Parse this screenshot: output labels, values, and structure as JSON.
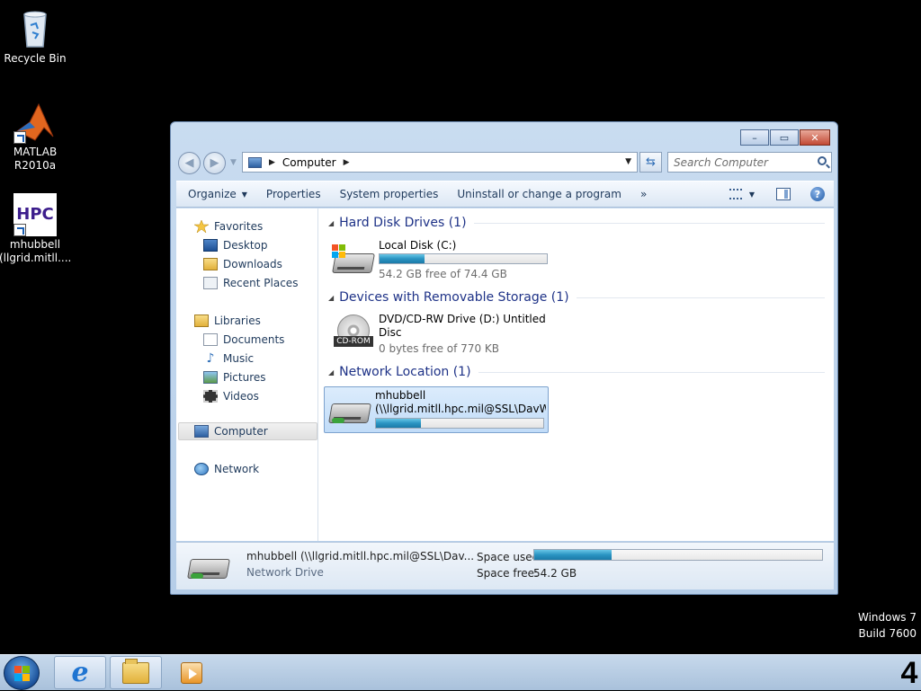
{
  "desktop": {
    "icons": [
      {
        "label": "Recycle Bin"
      },
      {
        "label": "MATLAB\nR2010a"
      },
      {
        "label": "mhubbell\n(llgrid.mitll...."
      }
    ],
    "hpc_logo_text": "HPC",
    "watermark": {
      "line1": "Windows 7",
      "line2": "Build 7600"
    }
  },
  "window": {
    "caption_buttons": {
      "minimize": "–",
      "maximize": "▭",
      "close": "✕"
    },
    "address": {
      "location": "Computer"
    },
    "search": {
      "placeholder": "Search Computer"
    },
    "commands": {
      "organize": "Organize",
      "properties": "Properties",
      "system_properties": "System properties",
      "uninstall": "Uninstall or change a program",
      "more": "»"
    },
    "nav": {
      "favorites": "Favorites",
      "desktop": "Desktop",
      "downloads": "Downloads",
      "recent": "Recent Places",
      "libraries": "Libraries",
      "documents": "Documents",
      "music": "Music",
      "pictures": "Pictures",
      "videos": "Videos",
      "computer": "Computer",
      "network": "Network"
    },
    "groups": {
      "hdd": "Hard Disk Drives (1)",
      "removable": "Devices with Removable Storage (1)",
      "network": "Network Location (1)"
    },
    "drives": {
      "c": {
        "name": "Local Disk (C:)",
        "free": "54.2 GB free of 74.4 GB",
        "used_fraction": 0.27
      },
      "d": {
        "name": "DVD/CD-RW Drive (D:) Untitled Disc",
        "free": "0 bytes free of 770 KB",
        "badge": "CD-ROM"
      },
      "net": {
        "name_line1": "mhubbell",
        "name_line2": "(\\\\llgrid.mitll.hpc.mil@SSL\\DavW...",
        "used_fraction": 0.27
      }
    },
    "details": {
      "title": "mhubbell (\\\\llgrid.mitll.hpc.mil@SSL\\Dav...",
      "subtitle": "Network Drive",
      "space_used_label": "Space used:",
      "space_free_label": "Space free:",
      "space_free_value": "54.2 GB",
      "used_fraction": 0.27
    }
  },
  "taskbar": {
    "tray_text": "4"
  },
  "colors": {
    "accent_fill": "#2a94c2",
    "group_header": "#1e3287",
    "close_button": "#c24a35"
  }
}
